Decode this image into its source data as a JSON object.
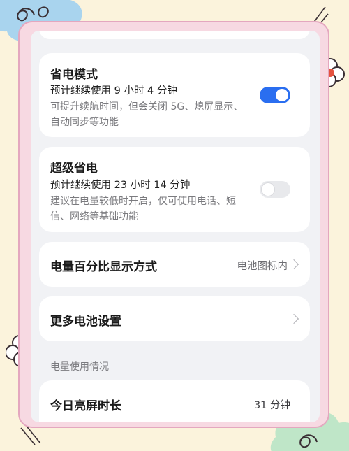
{
  "power_saving_mode": {
    "title": "省电模式",
    "estimate": "预计继续使用 9 小时 4 分钟",
    "description": "可提升续航时间，但会关闭 5G、熄屏显示、自动同步等功能",
    "enabled": true
  },
  "super_power_saving": {
    "title": "超级省电",
    "estimate": "预计继续使用 23 小时 14 分钟",
    "description": "建议在电量较低时开启，仅可使用电话、短信、网络等基础功能",
    "enabled": false
  },
  "battery_percentage_display": {
    "label": "电量百分比显示方式",
    "value": "电池图标内"
  },
  "more_battery_settings": {
    "label": "更多电池设置"
  },
  "usage_section": {
    "header": "电量使用情况",
    "screen_time_label": "今日亮屏时长",
    "screen_time_value": "31 分钟"
  },
  "colors": {
    "toggle_on": "#2a6ef0",
    "toggle_off": "#e8e9ec",
    "background": "#fbf3dc",
    "frame": "#e4a7bf"
  },
  "icons": [
    "chevron-right-icon",
    "chevron-right-icon"
  ]
}
